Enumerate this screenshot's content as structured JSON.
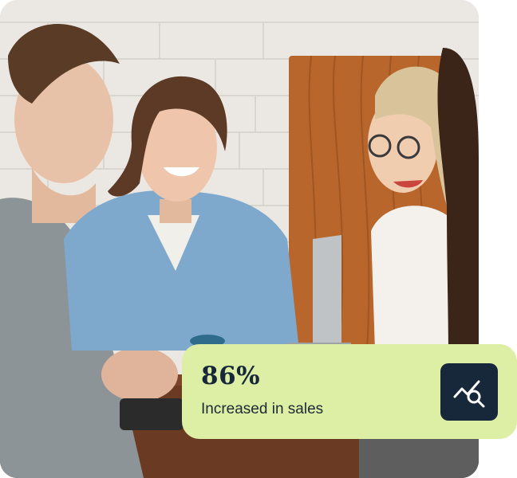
{
  "photo": {
    "icon": "group-photo"
  },
  "stat": {
    "value": "86%",
    "caption": "Increased in sales",
    "icon": "trend-search-icon",
    "colors": {
      "card_bg": "#ddeea5",
      "tile_bg": "#162839",
      "text": "#162839"
    }
  }
}
